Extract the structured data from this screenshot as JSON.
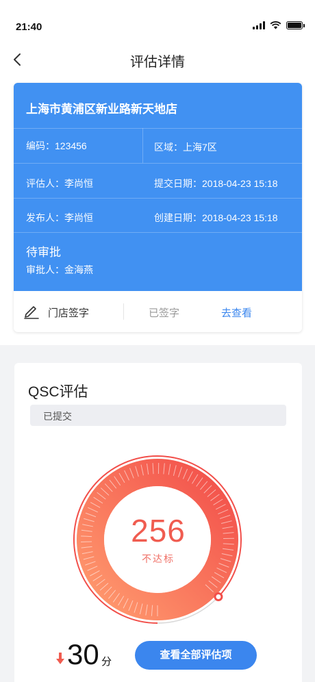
{
  "status_bar": {
    "time": "21:40"
  },
  "nav": {
    "title": "评估详情"
  },
  "store": {
    "name": "上海市黄浦区新业路新天地店",
    "code_label": "编码：",
    "code": "123456",
    "region_label": "区域：",
    "region": "上海7区",
    "evaluator_label": "评估人：",
    "evaluator": "李尚恒",
    "submit_date_label": "提交日期：",
    "submit_date": "2018-04-23  15:18",
    "publisher_label": "发布人：",
    "publisher": "李尚恒",
    "create_date_label": "创建日期：",
    "create_date": "2018-04-23  15:18",
    "status": "待审批",
    "approver_label": "审批人：",
    "approver": "金海燕"
  },
  "signature": {
    "label": "门店签字",
    "status": "已签字",
    "link": "去查看"
  },
  "qsc": {
    "title": "QSC评估",
    "badge": "已提交",
    "score": "256",
    "score_status": "不达标",
    "gauge_fraction": 0.87,
    "delta": "30",
    "delta_unit": "分",
    "view_all_button": "查看全部评估项"
  },
  "colors": {
    "primary_blue": "#4191f2",
    "button_blue": "#3b86ee",
    "gauge_start": "#ff9a6e",
    "gauge_end": "#f24f4a",
    "score_red": "#f05c50"
  }
}
